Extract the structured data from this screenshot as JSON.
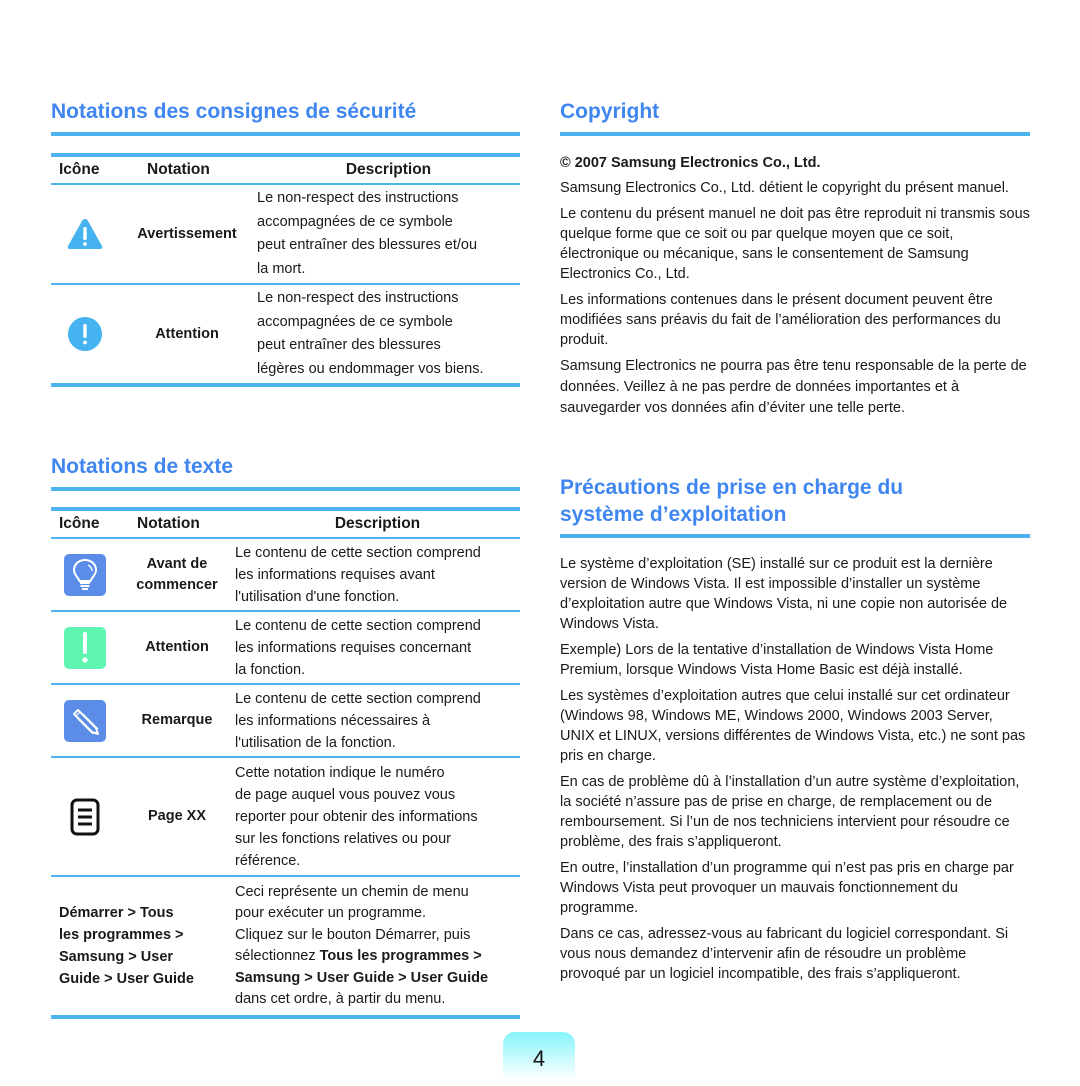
{
  "left": {
    "safety": {
      "title": "Notations des consignes de sécurité",
      "headers": {
        "icon": "Icône",
        "notation": "Notation",
        "description": "Description"
      },
      "rows": [
        {
          "icon": "warning-triangle-icon",
          "notation": "Avertissement",
          "description_lines": [
            "Le non-respect des instructions",
            "accompagnées de ce symbole",
            "peut entraîner des blessures et/ou",
            "la mort."
          ]
        },
        {
          "icon": "caution-circle-icon",
          "notation": "Attention",
          "description_lines": [
            "Le non-respect des instructions",
            "accompagnées de ce symbole",
            "peut entraîner des blessures",
            "légères ou endommager vos biens."
          ]
        }
      ]
    },
    "text": {
      "title": "Notations de texte",
      "headers": {
        "icon": "Icône",
        "notation": "Notation",
        "description": "Description"
      },
      "rows": [
        {
          "icon": "lightbulb-icon",
          "notation_lines": [
            "Avant de",
            "commencer"
          ],
          "description_lines": [
            "Le contenu de cette section comprend",
            "les informations requises avant",
            "l'utilisation d'une fonction."
          ]
        },
        {
          "icon": "exclamation-icon",
          "notation_lines": [
            "Attention"
          ],
          "description_lines": [
            "Le contenu de cette section comprend",
            "les informations requises concernant",
            "la fonction."
          ]
        },
        {
          "icon": "pencil-icon",
          "notation_lines": [
            "Remarque"
          ],
          "description_lines": [
            "Le contenu de cette section comprend",
            "les informations nécessaires à",
            "l'utilisation de la fonction."
          ]
        },
        {
          "icon": "page-reference-icon",
          "notation_lines": [
            "Page XX"
          ],
          "description_lines": [
            "Cette notation indique le numéro",
            "de page auquel vous pouvez vous",
            "reporter pour obtenir des informations",
            "sur les fonctions relatives ou pour",
            "référence."
          ]
        }
      ],
      "menu_row": {
        "path_lines": [
          "Démarrer > Tous",
          "les programmes >",
          "Samsung > User",
          "Guide > User Guide"
        ],
        "description_lines": [
          "Ceci représente un chemin de menu",
          "pour exécuter un programme.",
          "Cliquez sur le bouton Démarrer, puis"
        ],
        "select_prefix": "sélectionnez ",
        "select_bold_1": "Tous les programmes >",
        "select_bold_2": "Samsung > User Guide > User Guide",
        "select_suffix": "dans cet ordre, à partir du menu."
      }
    }
  },
  "right": {
    "copyright": {
      "title": "Copyright",
      "subhead": "© 2007 Samsung Electronics Co., Ltd.",
      "paragraphs": [
        "Samsung Electronics Co., Ltd. détient le copyright du présent manuel.",
        "Le contenu du présent manuel ne doit pas être reproduit ni transmis sous quelque forme que ce soit ou par quelque moyen que ce soit, électronique ou mécanique, sans le consentement de Samsung Electronics Co., Ltd.",
        "Les informations contenues dans le présent document peuvent être modifiées sans préavis du fait de l’amélioration des performances du produit.",
        "Samsung Electronics ne pourra pas être tenu responsable de la perte de données. Veillez à ne pas perdre de données importantes et à sauvegarder vos données afin d’éviter une telle perte."
      ]
    },
    "os": {
      "title_line1": "Précautions de prise en charge du",
      "title_line2": "système d’exploitation",
      "paragraphs": [
        "Le système d’exploitation (SE) installé sur ce produit est la dernière version de Windows Vista. Il est impossible d’installer un système d’exploitation autre que Windows Vista, ni une copie non autorisée de Windows Vista.",
        "Exemple) Lors de la tentative d’installation de Windows Vista Home Premium, lorsque Windows Vista Home Basic est déjà installé.",
        "Les systèmes d’exploitation autres que celui installé sur cet ordinateur (Windows 98, Windows ME, Windows 2000, Windows 2003 Server, UNIX et LINUX, versions différentes de Windows Vista, etc.) ne sont pas pris en charge.",
        "En cas de problème dû à l’installation d’un autre système d’exploitation, la société n’assure pas de prise en charge, de remplacement ou de remboursement. Si l’un de nos techniciens intervient pour résoudre ce problème, des frais s’appliqueront.",
        "En outre, l’installation d’un programme qui n’est pas pris en charge par Windows Vista peut provoquer un mauvais fonctionnement du programme.",
        "Dans ce cas, adressez-vous au fabricant du logiciel correspondant. Si vous nous demandez d’intervenir afin de résoudre un problème provoqué par un logiciel incompatible, des frais s’appliqueront."
      ]
    }
  },
  "footer": {
    "page_number": "4"
  },
  "colors": {
    "heading": "#3f86f0",
    "rule": "#4db3ee",
    "icon_blue": "#5b8de8",
    "icon_green": "#5ff5b0",
    "icon_cyan": "#45b3ef"
  }
}
